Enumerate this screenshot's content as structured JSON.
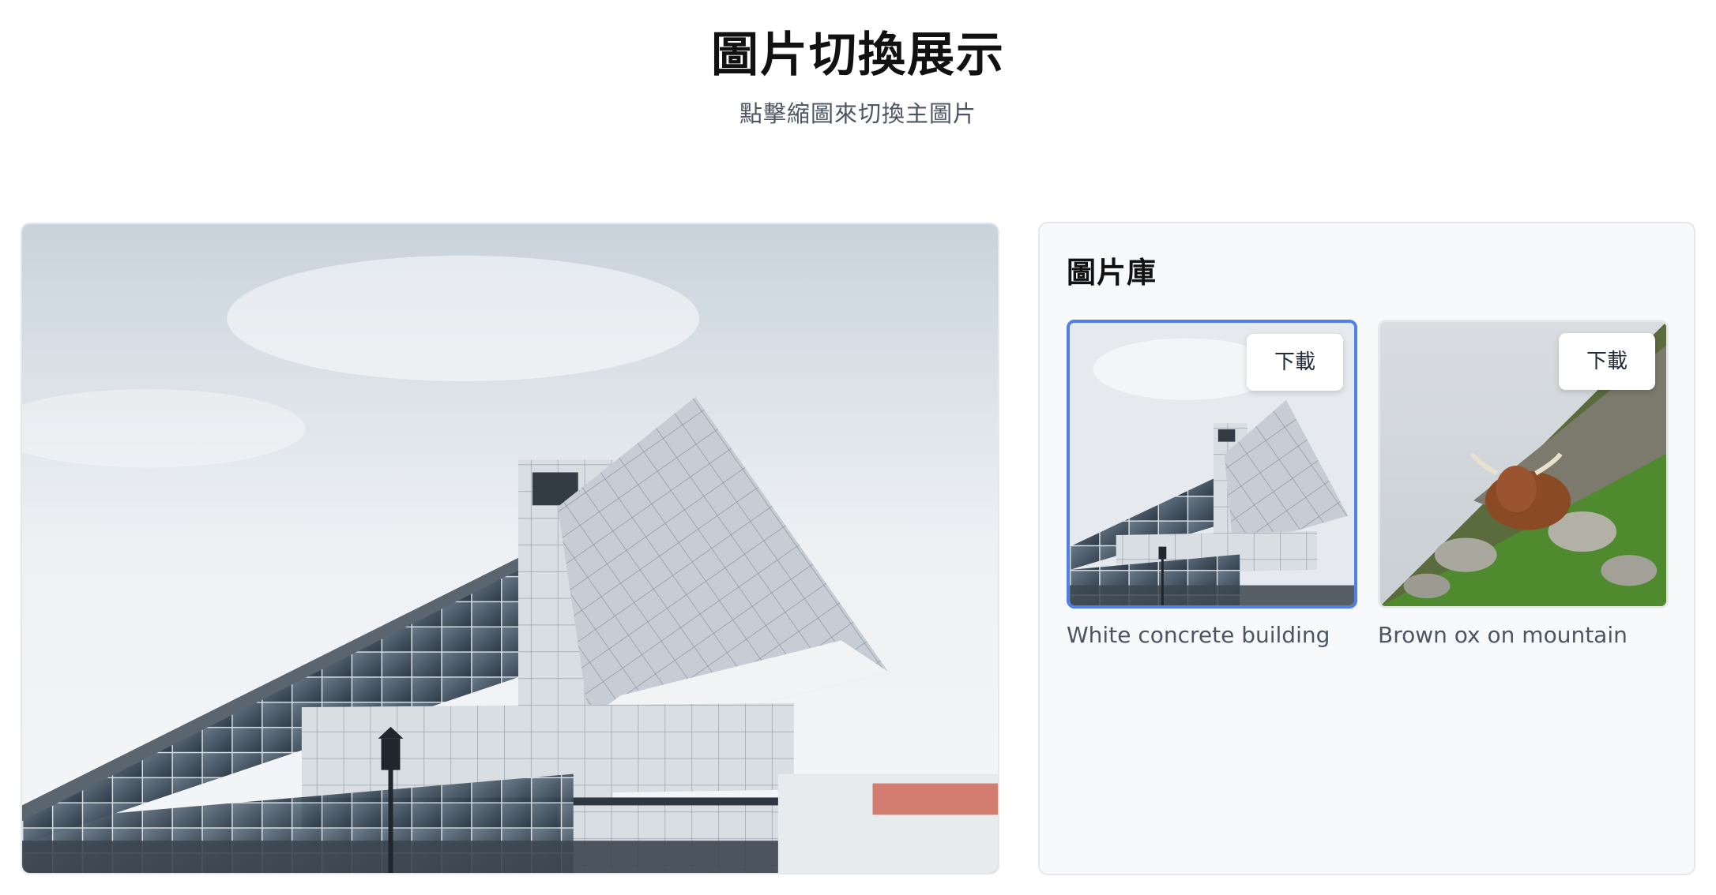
{
  "page": {
    "title": "圖片切換展示",
    "subtitle": "點擊縮圖來切換主圖片"
  },
  "main_image": {
    "alt": "White concrete building"
  },
  "gallery": {
    "title": "圖片庫",
    "selected_index": 0,
    "items": [
      {
        "caption": "White concrete building",
        "download_label": "下載",
        "selected": true
      },
      {
        "caption": "Brown ox on mountain",
        "download_label": "下載",
        "selected": false
      }
    ]
  },
  "colors": {
    "accent": "#4f7fe8",
    "panel_bg": "#f8f9fb",
    "border": "#e5e7eb",
    "text_secondary": "#4b5563"
  }
}
